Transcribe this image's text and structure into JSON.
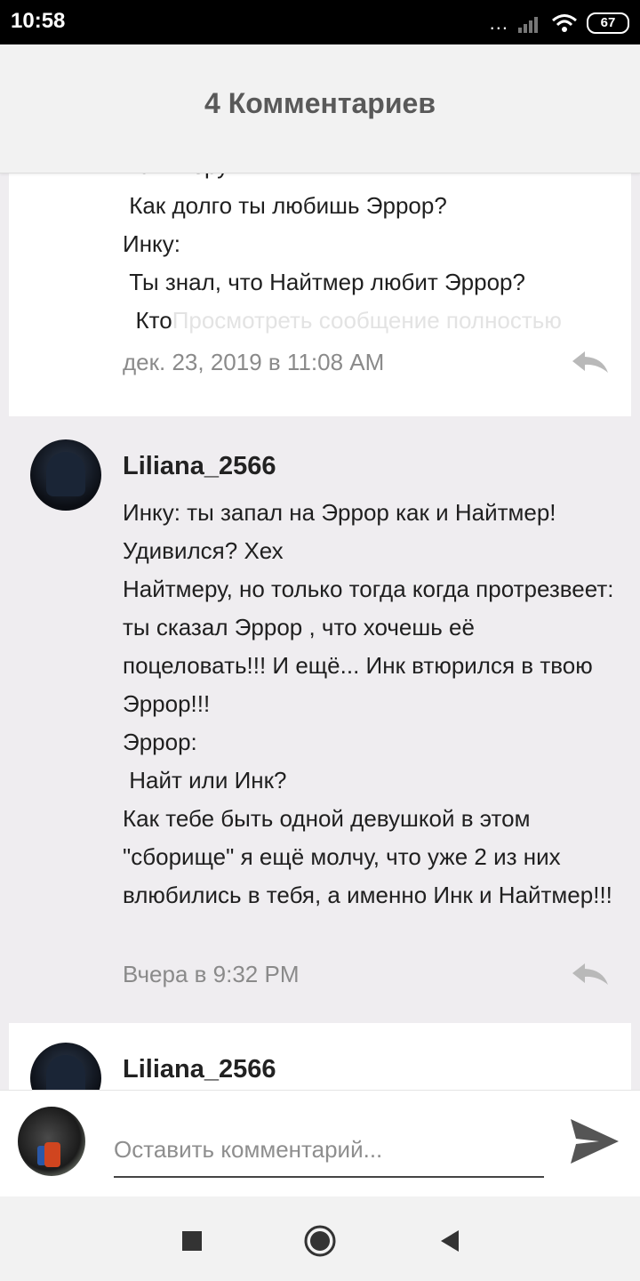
{
  "status_bar": {
    "time": "10:58",
    "dots": "...",
    "battery": "67"
  },
  "header": {
    "title": "4 Комментариев"
  },
  "comments": [
    {
      "partial_top_line": "Найтмеру:",
      "text": " Как долго ты любишь Эррор?\nИнку:\n Ты знал, что Найтмер любит Эррор?\n  Кто",
      "view_full": "Просмотреть сообщение полностью",
      "date": "дек. 23, 2019 в 11:08 AM"
    },
    {
      "username": "Liliana_2566",
      "text": "Инку: ты запал на Эррор как и Найтмер! Удивился? Хех\nНайтмеру, но только тогда когда протрезвеет: ты сказал Эррор , что хочешь её поцеловать!!! И ещё... Инк втюрился в твою Эррор!!!\nЭррор:\n Найт или Инк?\nКак тебе быть одной девушкой в этом \"сборище\" я ещё молчу, что уже 2 из них влюбились в тебя, а именно Инк и Найтмер!!!",
      "date": "Вчера в 9:32 PM"
    },
    {
      "username": "Liliana_2566"
    }
  ],
  "composer": {
    "placeholder": "Оставить комментарий..."
  },
  "colors": {
    "accent_gray": "#595959",
    "meta_gray": "#8a8a8a",
    "card_white": "#ffffff",
    "feed_bg": "#efedf0"
  }
}
